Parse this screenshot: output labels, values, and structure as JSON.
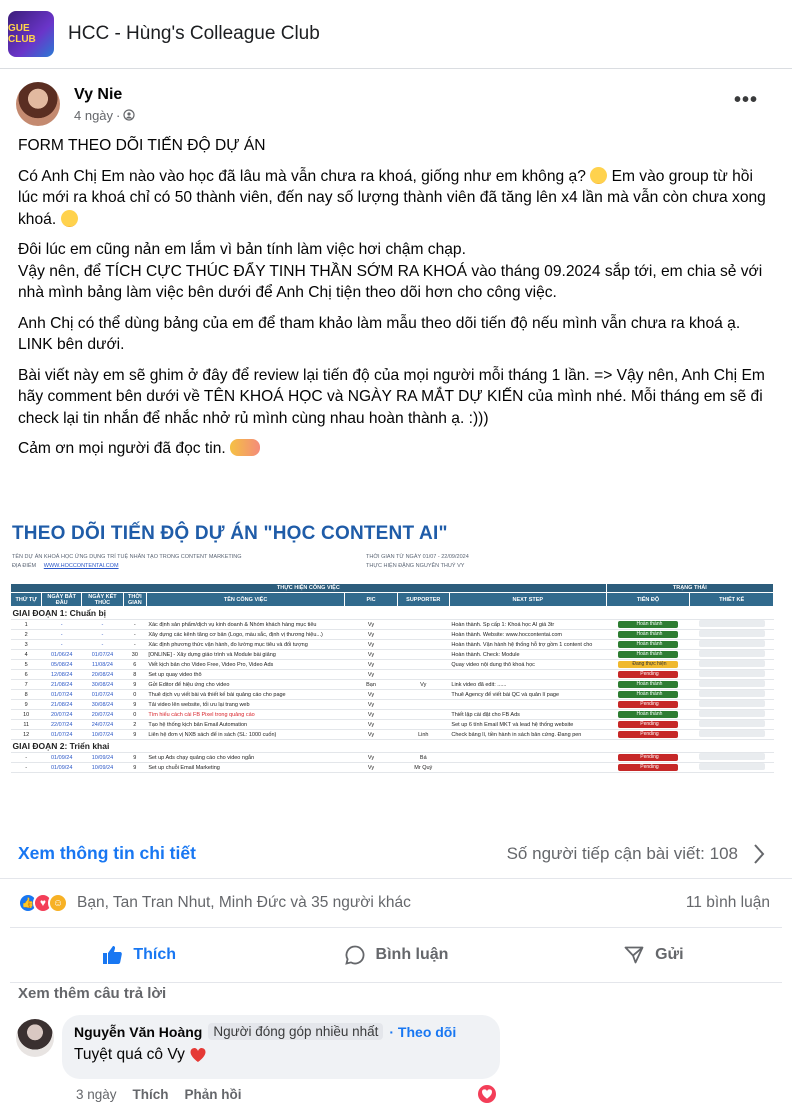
{
  "group": {
    "name": "HCC - Hùng's Colleague Club",
    "thumb_text": "GUE CLUB"
  },
  "post": {
    "author": "Vy Nie",
    "time": "4 ngày",
    "paragraphs": [
      "FORM THEO DÕI TIẾN ĐỘ DỰ ÁN",
      "Có Anh Chị Em nào vào học đã lâu mà vẫn chưa ra khoá, giống như em không ạ?",
      "Em vào group từ hồi lúc mới ra khoá chỉ có 50 thành viên, đến nay số lượng thành viên đã tăng lên x4 lần mà vẫn còn chưa xong khoá.",
      "Đôi lúc em cũng nản em lắm vì bản tính làm việc hơi chậm chạp.",
      "Vậy nên, để TÍCH CỰC THÚC ĐẨY TINH THẦN SỚM RA KHOÁ  vào tháng 09.2024 sắp tới, em chia sẻ với nhà mình bảng làm việc bên dưới để Anh Chị tiện theo dõi hơn cho công việc.",
      "Anh Chị có thể dùng bảng của em để tham khảo làm mẫu theo dõi tiến độ nếu mình vẫn chưa ra khoá ạ.",
      "LINK bên dưới.",
      "Bài viết này em sẽ ghim ở đây để review lại tiến độ của mọi người mỗi tháng 1 lần. => Vậy nên, Anh Chị Em hãy comment bên dưới về TÊN KHOÁ HỌC và NGÀY RA MẮT DỰ KIẾN của mình nhé. Mỗi tháng em sẽ đi check lại tin nhắn để nhắc nhở rủ mình cùng nhau hoàn thành ạ. :)))",
      "Cảm ơn mọi người đã đọc tin."
    ]
  },
  "sheet": {
    "title": "THEO DÕI TIẾN ĐỘ DỰ ÁN \"HỌC CONTENT AI\"",
    "meta_left_1": "TÊN DỰ ÁN     KHOÁ HỌC ỨNG DỤNG TRÍ TUỆ NHÂN TẠO TRONG CONTENT MARKETING",
    "meta_left_2_label": "ĐỊA ĐIỂM",
    "meta_left_2_value": "WWW.HOCCONTENTAI.COM",
    "meta_right_1": "THỜI GIAN      TỪ NGÀY 01/07 - 22/09/2024",
    "meta_right_2": "THỰC HIỆN      ĐẶNG NGUYỄN THUÝ VY",
    "group_header_left": "THỰC HIỆN CÔNG VIỆC",
    "group_header_right": "TRẠNG THÁI",
    "headers": [
      "THỨ TỰ",
      "NGÀY BẮT ĐẦU",
      "NGÀY KẾT THÚC",
      "THỜI GIAN",
      "TÊN CÔNG VIỆC",
      "PIC",
      "SUPPORTER",
      "NEXT STEP",
      "TIẾN ĐỘ",
      "THIẾT KẾ"
    ],
    "phase1": "GIAI ĐOẠN 1: Chuẩn bị",
    "phase2": "GIAI ĐOẠN 2: Triển khai",
    "rows1": [
      {
        "no": "1",
        "start": "-",
        "end": "-",
        "days": "-",
        "task": "Xác định sản phẩm/dịch vụ kinh doanh & Nhóm khách hàng mục tiêu",
        "pic": "Vy",
        "sup": "",
        "next": "Hoàn thành. Sp cấp 1: Khoá học AI giá 3tr",
        "status": "Hoàn thành",
        "cls": "done"
      },
      {
        "no": "2",
        "start": "-",
        "end": "-",
        "days": "-",
        "task": "Xây dựng các kênh tăng cơ bản (Logo, màu sắc, định vị thương hiệu...)",
        "pic": "Vy",
        "sup": "",
        "next": "Hoàn thành. Website: www.hoccontentai.com",
        "status": "Hoàn thành",
        "cls": "done"
      },
      {
        "no": "3",
        "start": "-",
        "end": "-",
        "days": "-",
        "task": "Xác định phương thức vận hành, đo lường mục tiêu và đối tượng",
        "pic": "Vy",
        "sup": "",
        "next": "Hoàn thành. Vận hành hệ thống hỗ trợ gồm 1 content cho",
        "status": "Hoàn thành",
        "cls": "done"
      },
      {
        "no": "4",
        "start": "01/06/24",
        "end": "01/07/24",
        "days": "30",
        "task": "[ONLINE] - Xây dựng giáo trình và Module bài giảng",
        "pic": "Vy",
        "sup": "",
        "next": "Hoàn thành. Check: Module",
        "status": "Hoàn thành",
        "cls": "done"
      },
      {
        "no": "5",
        "start": "05/08/24",
        "end": "11/08/24",
        "days": "6",
        "task": "Viết kịch bản cho Video Free, Video Pro, Video Ads",
        "pic": "Vy",
        "sup": "",
        "next": "Quay video nội dung thô khoá học",
        "status": "Đang thực hiện",
        "cls": "progress"
      },
      {
        "no": "6",
        "start": "12/08/24",
        "end": "20/08/24",
        "days": "8",
        "task": "Set up quay video thô",
        "pic": "Vy",
        "sup": "",
        "next": "",
        "status": "Pending",
        "cls": "pending"
      },
      {
        "no": "7",
        "start": "21/08/24",
        "end": "30/08/24",
        "days": "9",
        "task": "Gửi Editor để hiệu ứng cho video",
        "pic": "Bạn",
        "sup": "Vy",
        "next": "Link video đã edit: ......",
        "status": "Hoàn thành",
        "cls": "done"
      },
      {
        "no": "8",
        "start": "01/07/24",
        "end": "01/07/24",
        "days": "0",
        "task": "Thuê dịch vụ viết bài và thiết kế bài quảng cáo cho page",
        "pic": "Vy",
        "sup": "",
        "next": "Thuê Agency để viết bài QC và quản lí page",
        "status": "Hoàn thành",
        "cls": "done"
      },
      {
        "no": "9",
        "start": "21/08/24",
        "end": "30/08/24",
        "days": "9",
        "task": "Tải video lên website, tối ưu lại trang web",
        "pic": "Vy",
        "sup": "",
        "next": "",
        "status": "Pending",
        "cls": "pending"
      },
      {
        "no": "10",
        "start": "20/07/24",
        "end": "20/07/24",
        "days": "0",
        "task": "Tìm hiểu cách cài FB Pixel trong quảng cáo",
        "pic": "Vy",
        "sup": "",
        "next": "Thiết lập cài đặt cho FB Ads",
        "status": "Hoàn thành",
        "cls": "done",
        "red": true
      },
      {
        "no": "11",
        "start": "22/07/24",
        "end": "24/07/24",
        "days": "2",
        "task": "Tạo hệ thống kịch bản Email Automation",
        "pic": "Vy",
        "sup": "",
        "next": "Set up 6 tính Email MKT và lead hệ thống website",
        "status": "Pending",
        "cls": "pending"
      },
      {
        "no": "12",
        "start": "01/07/24",
        "end": "10/07/24",
        "days": "9",
        "task": "Liên hệ đơn vị NXB sách để in sách (SL: 1000 cuốn)",
        "pic": "Vy",
        "sup": "Linh",
        "next": "Check bảng lí, tiền hành in sách bản cứng. Đang pen",
        "status": "Pending",
        "cls": "pending"
      }
    ],
    "rows2": [
      {
        "no": "-",
        "start": "01/09/24",
        "end": "10/09/24",
        "days": "9",
        "task": "Set up Ads chạy quảng cáo cho video ngắn",
        "pic": "Vy",
        "sup": "Bá",
        "next": "",
        "status": "Pending",
        "cls": "pending"
      },
      {
        "no": "-",
        "start": "01/09/24",
        "end": "10/09/24",
        "days": "9",
        "task": "Set up chuỗi Email Marketing",
        "pic": "Vy",
        "sup": "Mr Quý",
        "next": "",
        "status": "Pending",
        "cls": "pending"
      }
    ]
  },
  "stats": {
    "detail_link": "Xem thông tin chi tiết",
    "reach": "Số người tiếp cận bài viết: 108",
    "reactions_text": "Bạn, Tan Tran Nhut, Minh Đức và 35 người khác",
    "comment_count": "11 bình luận"
  },
  "actions": {
    "like": "Thích",
    "comment": "Bình luận",
    "share": "Gửi"
  },
  "comments": {
    "more": "Xem thêm câu trả lời",
    "name": "Nguyễn Văn Hoàng",
    "badge": "Người đóng góp nhiều nhất",
    "follow": "· Theo dõi",
    "text": "Tuyệt quá cô Vy",
    "time": "3 ngày",
    "like": "Thích",
    "reply": "Phản hồi"
  },
  "colors": {
    "accent": "#1877f2",
    "sheet_header": "#2c5d7c",
    "title_blue": "#1f5ca8"
  }
}
